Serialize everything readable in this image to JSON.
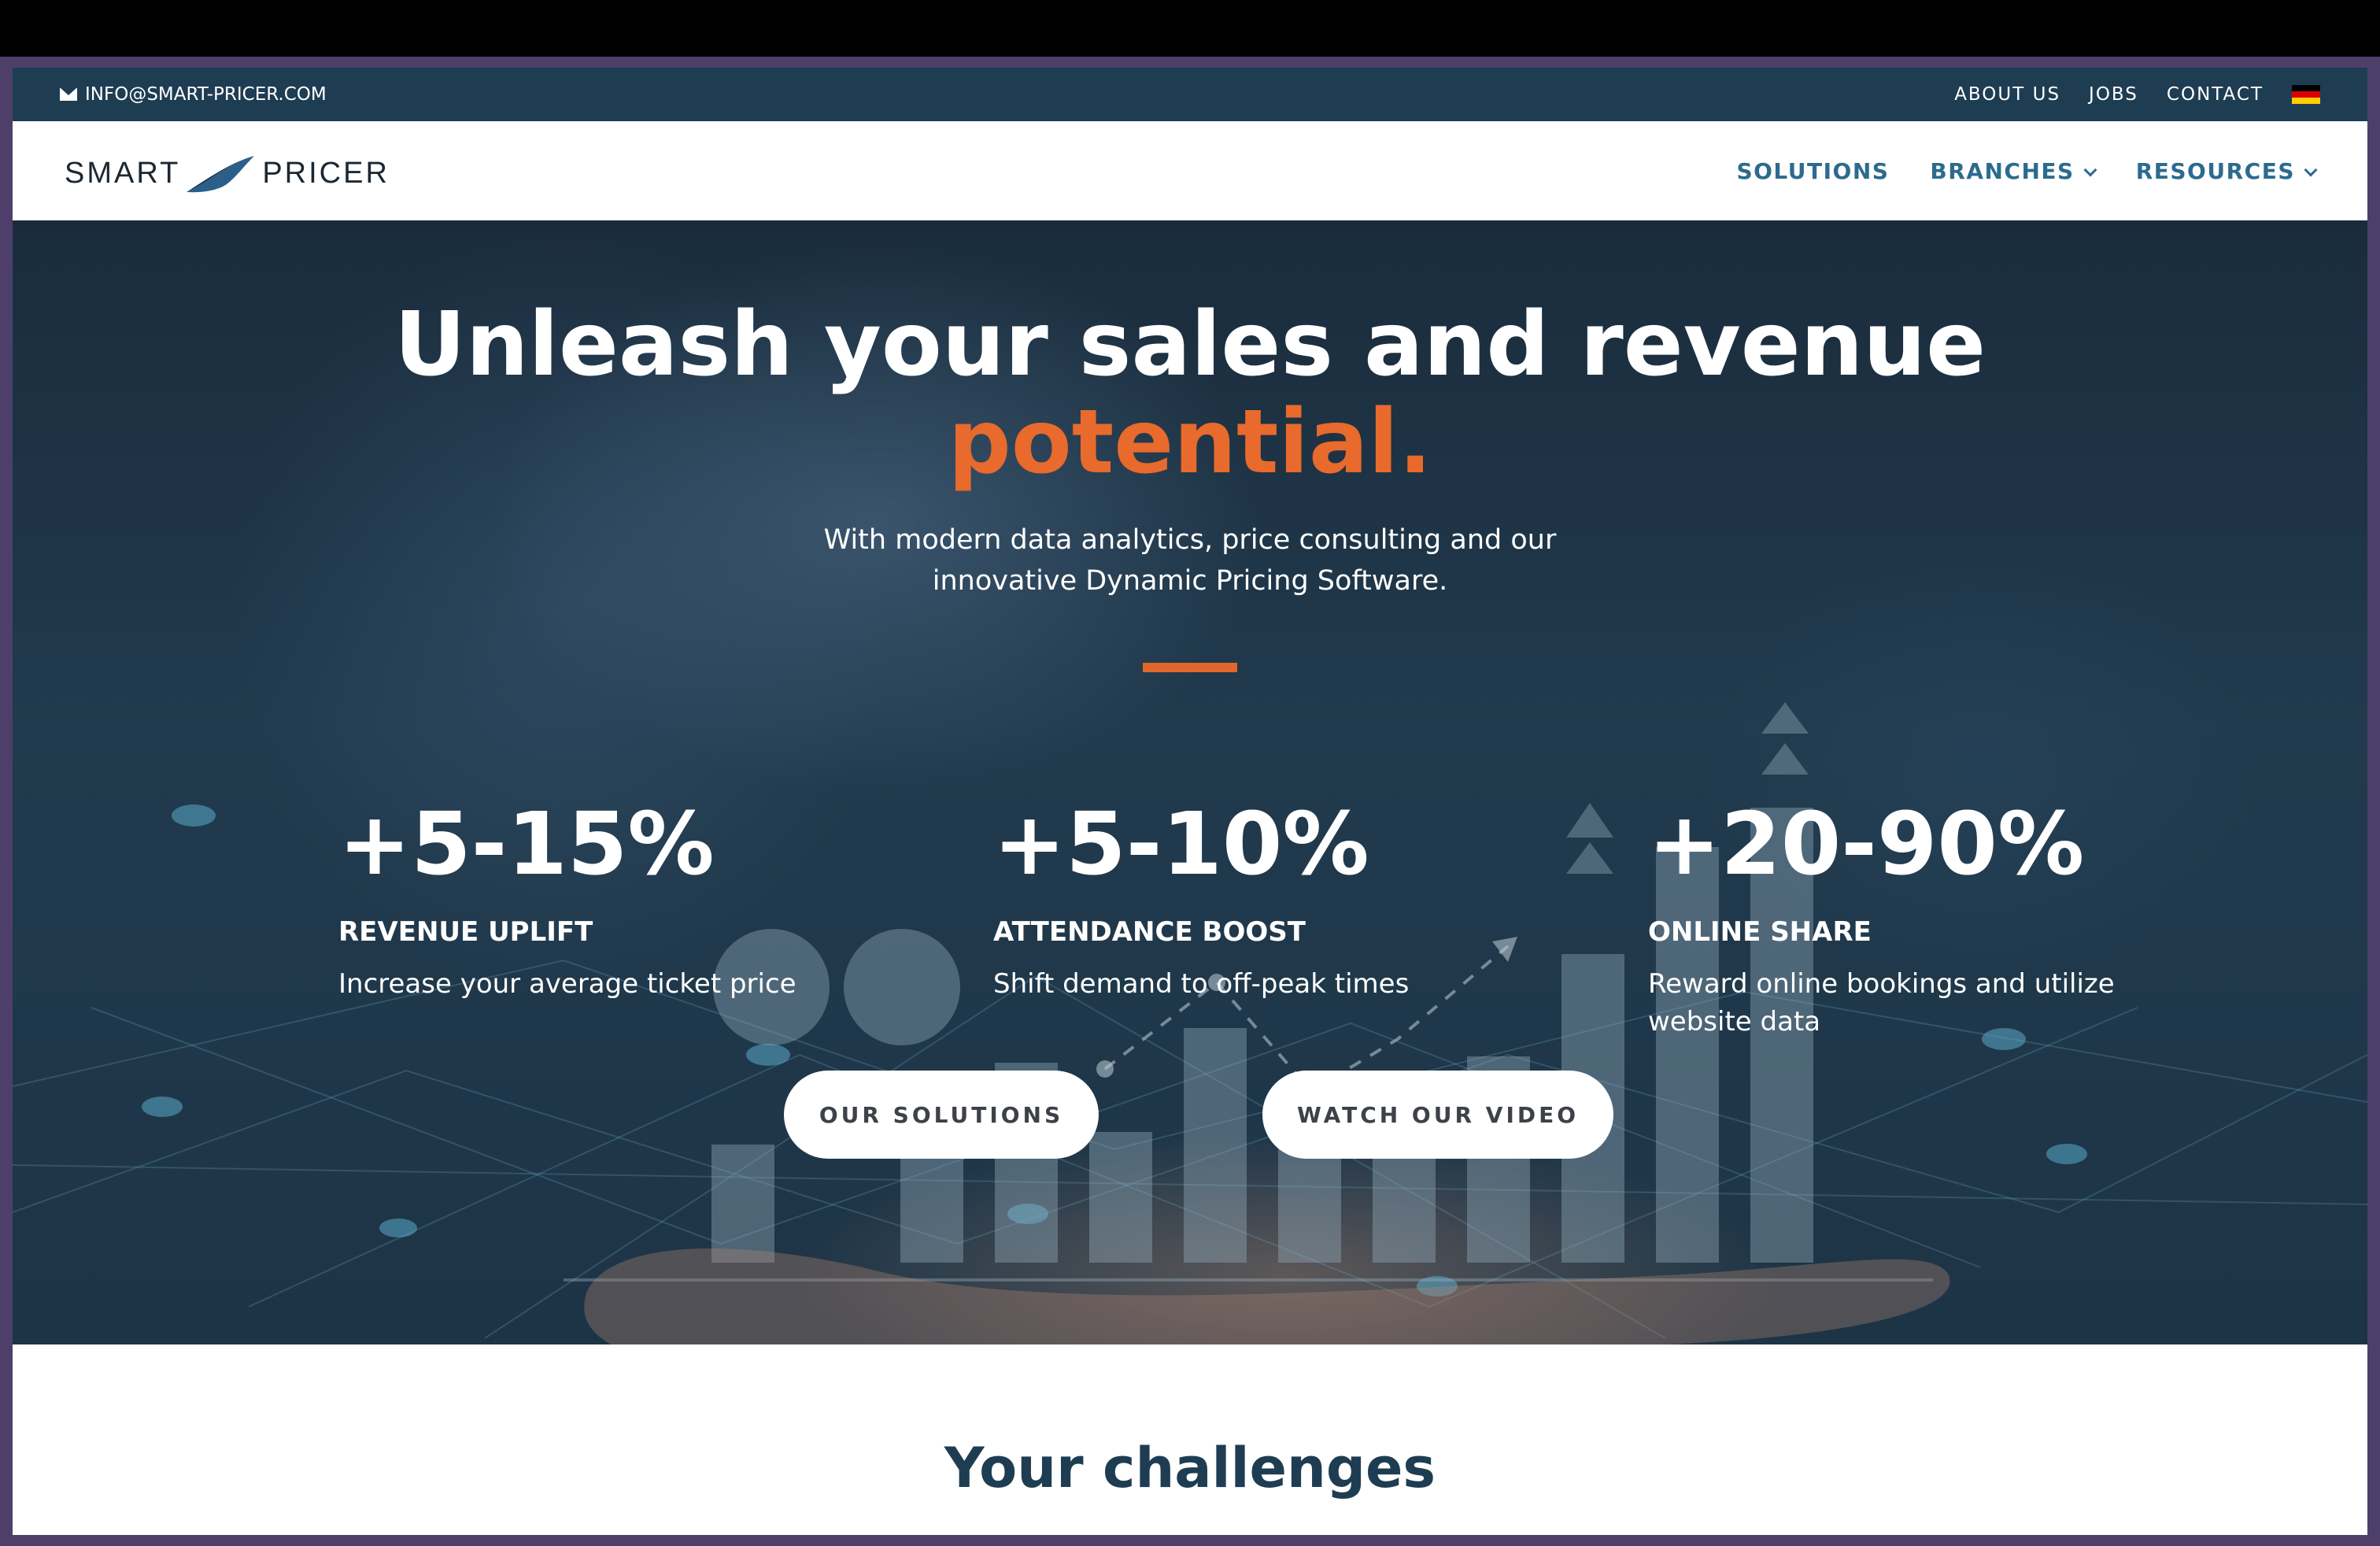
{
  "topbar": {
    "email": "INFO@SMART-PRICER.COM",
    "links": [
      "ABOUT US",
      "JOBS",
      "CONTACT"
    ],
    "flag_colors": [
      "#000000",
      "#dd0000",
      "#ffce00"
    ]
  },
  "nav": {
    "logo_left": "SMART",
    "logo_right": "PRICER",
    "items": [
      {
        "label": "SOLUTIONS",
        "dropdown": false
      },
      {
        "label": "BRANCHES",
        "dropdown": true
      },
      {
        "label": "RESOURCES",
        "dropdown": true
      }
    ]
  },
  "hero": {
    "headline_line1": "Unleash your sales and revenue",
    "headline_accent": "potential.",
    "subline": "With modern data analytics, price consulting and our innovative Dynamic Pricing Software.",
    "stats": [
      {
        "value": "+5-15%",
        "label": "REVENUE UPLIFT",
        "desc": "Increase your average ticket price"
      },
      {
        "value": "+5-10%",
        "label": "ATTENDANCE BOOST",
        "desc": "Shift demand to off-peak times"
      },
      {
        "value": "+20-90%",
        "label": "ONLINE SHARE",
        "desc": "Reward online bookings and utilize website data"
      }
    ],
    "buttons": {
      "primary": "OUR SOLUTIONS",
      "secondary": "WATCH OUR VIDEO"
    }
  },
  "section": {
    "title": "Your challenges"
  },
  "colors": {
    "accent": "#e86a2c",
    "topbar": "#1e3d52",
    "nav_link": "#2c6b8f"
  }
}
